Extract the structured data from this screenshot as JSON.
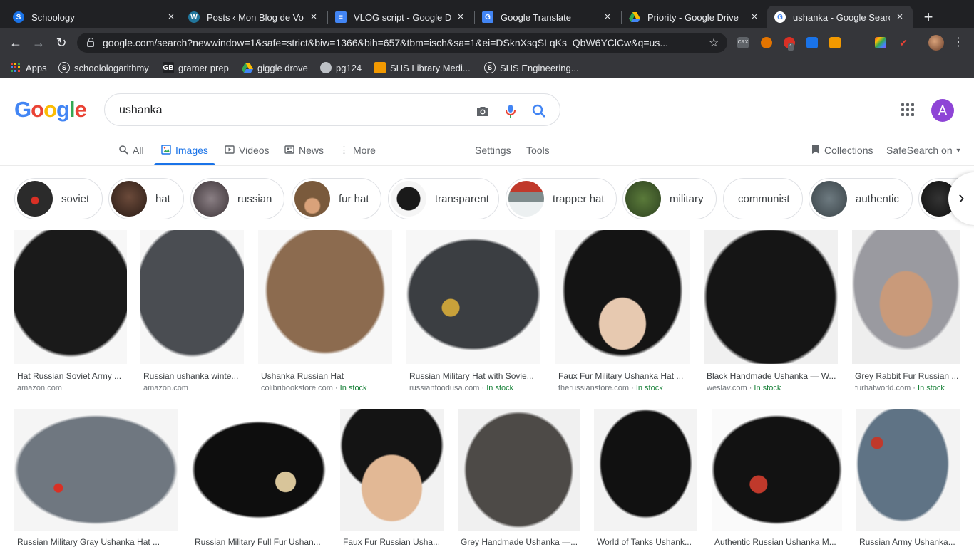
{
  "browser": {
    "tabs": [
      {
        "title": "Schoology",
        "favicon": "schoology-icon",
        "color": "#1a73e8",
        "glyph": "S"
      },
      {
        "title": "Posts ‹ Mon Blog de Voya",
        "favicon": "wordpress-icon",
        "color": "#21759b",
        "glyph": "W"
      },
      {
        "title": "VLOG script - Google Do",
        "favicon": "google-docs-icon",
        "color": "#4285f4",
        "glyph": "≡"
      },
      {
        "title": "Google Translate",
        "favicon": "google-translate-icon",
        "color": "#4285f4",
        "glyph": "G"
      },
      {
        "title": "Priority - Google Drive",
        "favicon": "google-drive-icon",
        "color": "#fbbc04",
        "glyph": "▲"
      },
      {
        "title": "ushanka - Google Search",
        "favicon": "google-icon",
        "color": "#ffffff",
        "glyph": "G"
      }
    ],
    "url": "google.com/search?newwindow=1&safe=strict&biw=1366&bih=657&tbm=isch&sa=1&ei=DSknXsqSLqKs_QbW6YClCw&q=us...",
    "bookmarks": [
      {
        "label": "Apps",
        "icon": "apps-grid-icon"
      },
      {
        "label": "schoolologarithmy",
        "icon": "schoology-icon"
      },
      {
        "label": "gramer prep",
        "icon": "gb-icon"
      },
      {
        "label": "giggle drove",
        "icon": "google-drive-icon"
      },
      {
        "label": "pg124",
        "icon": "globe-icon"
      },
      {
        "label": "SHS Library Medi...",
        "icon": "library-icon"
      },
      {
        "label": "SHS Engineering...",
        "icon": "schoology-icon"
      }
    ],
    "extension_badge": "1"
  },
  "google": {
    "query": "ushanka",
    "avatar_letter": "A",
    "tabs": {
      "all": "All",
      "images": "Images",
      "videos": "Videos",
      "news": "News",
      "more": "More",
      "settings": "Settings",
      "tools": "Tools"
    },
    "collections": "Collections",
    "safesearch": "SafeSearch on"
  },
  "chips": [
    {
      "label": "soviet"
    },
    {
      "label": "hat"
    },
    {
      "label": "russian"
    },
    {
      "label": "fur hat"
    },
    {
      "label": "transparent"
    },
    {
      "label": "trapper hat"
    },
    {
      "label": "military"
    },
    {
      "label": "communist"
    },
    {
      "label": "authentic"
    }
  ],
  "results_row1": [
    {
      "title": "Hat Russian Soviet Army ...",
      "source": "amazon.com",
      "stock": ""
    },
    {
      "title": "Russian ushanka winte...",
      "source": "amazon.com",
      "stock": ""
    },
    {
      "title": "Ushanka Russian Hat",
      "source": "colibribookstore.com · ",
      "stock": "In stock"
    },
    {
      "title": "Russian Military Hat with Sovie...",
      "source": "russianfoodusa.com · ",
      "stock": "In stock"
    },
    {
      "title": "Faux Fur Military Ushanka Hat ...",
      "source": "therussianstore.com · ",
      "stock": "In stock"
    },
    {
      "title": "Black Handmade Ushanka — W...",
      "source": "weslav.com · ",
      "stock": "In stock"
    },
    {
      "title": "Grey Rabbit Fur Russian ...",
      "source": "furhatworld.com · ",
      "stock": "In stock"
    }
  ],
  "results_row2": [
    {
      "title": "Russian Military Gray Ushanka Hat ..."
    },
    {
      "title": "Russian Military Full Fur Ushan..."
    },
    {
      "title": "Faux Fur Russian Usha..."
    },
    {
      "title": "Grey Handmade Ushanka —..."
    },
    {
      "title": "World of Tanks Ushank..."
    },
    {
      "title": "Authentic Russian Ushanka M..."
    },
    {
      "title": "Russian Army Ushanka..."
    }
  ],
  "colors": {
    "accent": "#1a73e8",
    "in_stock": "#188038",
    "browser_dark": "#202124",
    "browser_toolbar": "#35363a"
  }
}
